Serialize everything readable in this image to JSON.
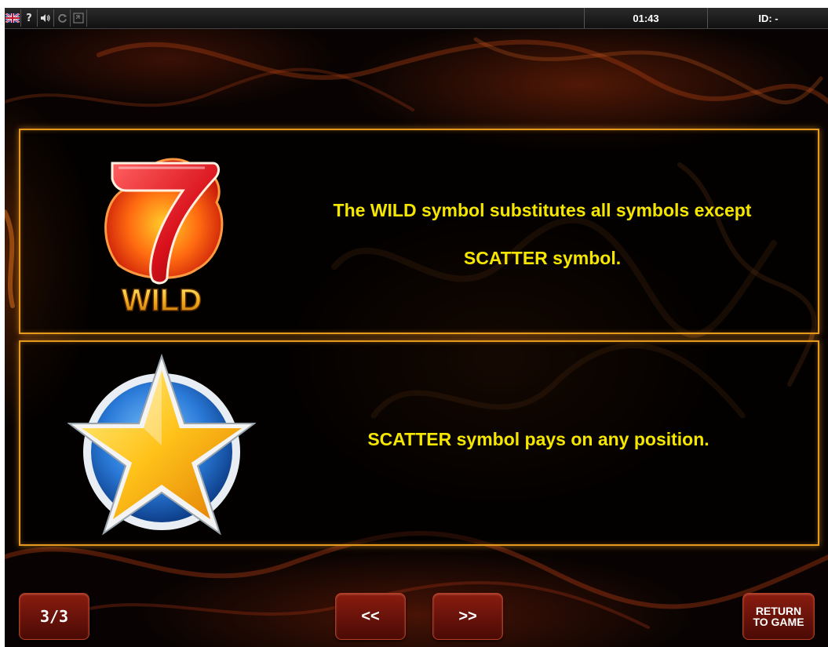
{
  "topbar": {
    "language_flag": "uk-flag-icon",
    "help_label": "?",
    "sound_icon": "speaker-icon",
    "reload_icon": "reload-icon",
    "fullscreen_icon": "fullscreen-icon",
    "clock": "01:43",
    "id": "ID: -"
  },
  "panels": [
    {
      "symbol": "wild-seven-icon",
      "symbol_label": "WILD",
      "text_line1": "The WILD symbol substitutes all symbols except",
      "text_line2": "SCATTER symbol."
    },
    {
      "symbol": "scatter-star-icon",
      "text_line1": "SCATTER symbol pays on any position."
    }
  ],
  "footer": {
    "page": "3/3",
    "prev_label": "<<",
    "next_label": ">>",
    "return_line1": "RETURN",
    "return_line2": "TO GAME"
  },
  "colors": {
    "text": "#f5e600",
    "panel_border": "#e59a1d",
    "button": "#7a1a0e"
  }
}
